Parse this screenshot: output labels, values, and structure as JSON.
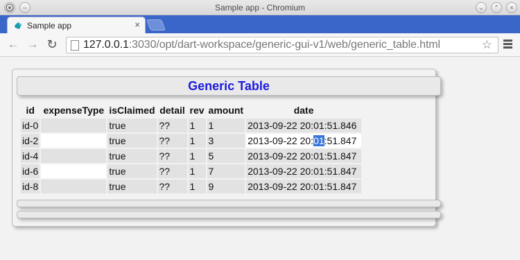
{
  "window": {
    "title": "Sample app - Chromium"
  },
  "tab": {
    "title": "Sample app",
    "close": "×"
  },
  "toolbar": {
    "url_host": "127.0.0.1",
    "url_rest": ":3030/opt/dart-workspace/generic-gui-v1/web/generic_table.html",
    "back": "←",
    "forward": "→",
    "reload": "↻",
    "star": "☆"
  },
  "colors": {
    "tab_strip": "#3a66c9",
    "title_text": "#1c1ce0",
    "selection": "#3874d8"
  },
  "panel": {
    "title": "Generic Table"
  },
  "table": {
    "columns": [
      "id",
      "expenseType",
      "isClaimed",
      "detail",
      "rev",
      "amount",
      "date"
    ],
    "rows": [
      {
        "id": "id-0",
        "expenseType": "",
        "isClaimed": "true",
        "detail": "??",
        "rev": "1",
        "amount": "1",
        "date_pre": "2013-09-22 20:",
        "date_sel": "01",
        "date_post": ":51.846"
      },
      {
        "id": "id-2",
        "expenseType": "",
        "isClaimed": "true",
        "detail": "??",
        "rev": "1",
        "amount": "3",
        "date_pre": "2013-09-22 20:",
        "date_sel": "01",
        "date_post": ":51.847"
      },
      {
        "id": "id-4",
        "expenseType": "",
        "isClaimed": "true",
        "detail": "??",
        "rev": "1",
        "amount": "5",
        "date_pre": "2013-09-22 20:",
        "date_sel": "01",
        "date_post": ":51.847"
      },
      {
        "id": "id-6",
        "expenseType": "",
        "isClaimed": "true",
        "detail": "??",
        "rev": "1",
        "amount": "7",
        "date_pre": "2013-09-22 20:",
        "date_sel": "01",
        "date_post": ":51.847"
      },
      {
        "id": "id-8",
        "expenseType": "",
        "isClaimed": "true",
        "detail": "??",
        "rev": "1",
        "amount": "9",
        "date_pre": "2013-09-22 20:",
        "date_sel": "01",
        "date_post": ":51.847"
      }
    ]
  }
}
